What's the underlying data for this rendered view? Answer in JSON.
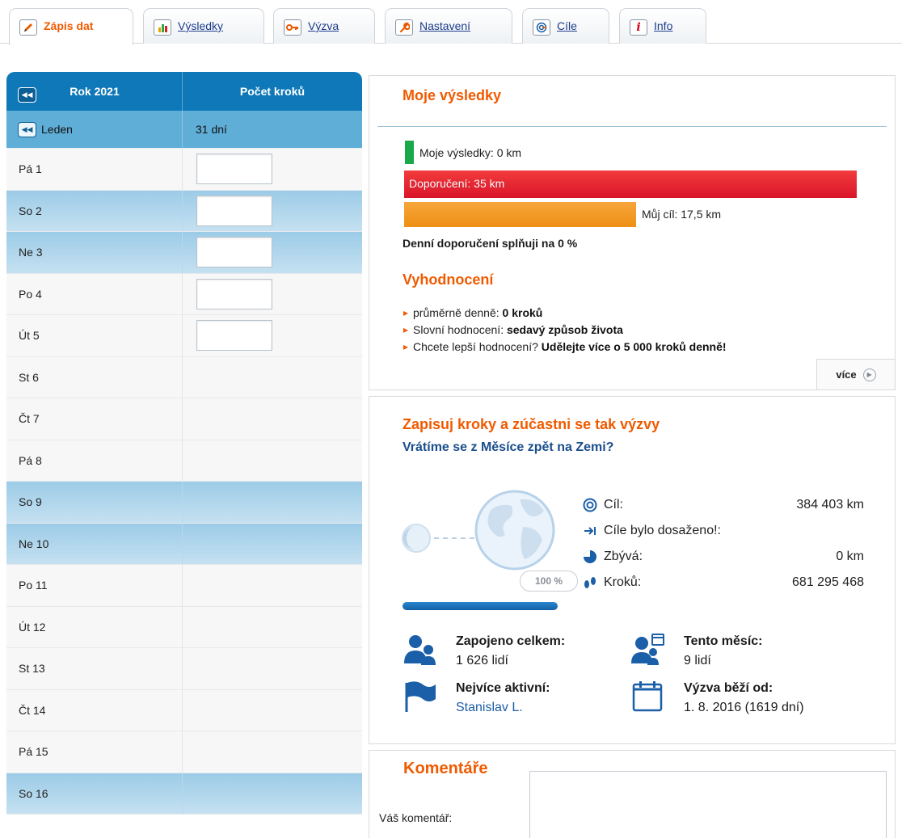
{
  "tabs": [
    {
      "label": "Zápis dat",
      "icon": "pencil-icon",
      "active": true
    },
    {
      "label": "Výsledky",
      "icon": "bar-chart-icon",
      "active": false
    },
    {
      "label": "Výzva",
      "icon": "key-icon",
      "active": false
    },
    {
      "label": "Nastavení",
      "icon": "wrench-icon",
      "active": false
    },
    {
      "label": "Cíle",
      "icon": "target-icon",
      "active": false
    },
    {
      "label": "Info",
      "icon": "info-icon",
      "active": false
    }
  ],
  "calendar": {
    "year_label": "Rok 2021",
    "steps_header": "Počet kroků",
    "month_label": "Leden",
    "month_days": "31 dní",
    "days": [
      {
        "label": "Pá 1",
        "weekend": false,
        "editable": true
      },
      {
        "label": "So 2",
        "weekend": true,
        "editable": true
      },
      {
        "label": "Ne 3",
        "weekend": true,
        "editable": true
      },
      {
        "label": "Po 4",
        "weekend": false,
        "editable": true
      },
      {
        "label": "Út 5",
        "weekend": false,
        "editable": true
      },
      {
        "label": "St 6",
        "weekend": false,
        "editable": false
      },
      {
        "label": "Čt 7",
        "weekend": false,
        "editable": false
      },
      {
        "label": "Pá 8",
        "weekend": false,
        "editable": false
      },
      {
        "label": "So 9",
        "weekend": true,
        "editable": false
      },
      {
        "label": "Ne 10",
        "weekend": true,
        "editable": false
      },
      {
        "label": "Po 11",
        "weekend": false,
        "editable": false
      },
      {
        "label": "Út 12",
        "weekend": false,
        "editable": false
      },
      {
        "label": "St 13",
        "weekend": false,
        "editable": false
      },
      {
        "label": "Čt 14",
        "weekend": false,
        "editable": false
      },
      {
        "label": "Pá 15",
        "weekend": false,
        "editable": false
      },
      {
        "label": "So 16",
        "weekend": true,
        "editable": false
      }
    ]
  },
  "results": {
    "title": "Moje výsledky",
    "mine_label": "Moje výsledky: 0 km",
    "recommended_label": "Doporučení: 35 km",
    "goal_label": "Můj cíl: 17,5 km",
    "daily_prefix": "Denní doporučení splňuji na",
    "daily_value": "0 %",
    "evaluation_title": "Vyhodnocení",
    "bullets": [
      {
        "text": "průměrně denně: ",
        "bold": "0 kroků"
      },
      {
        "text": "Slovní hodnocení: ",
        "bold": "sedavý způsob života"
      },
      {
        "text": "Chcete lepší hodnocení? ",
        "bold": "Udělejte více o 5 000 kroků denně!"
      }
    ],
    "more_label": "více",
    "colors": {
      "mine": "#19a84a",
      "recommended": "#e0202e",
      "goal": "#f09a22"
    }
  },
  "challenge": {
    "title": "Zapisuj kroky a zúčastni se tak výzvy",
    "subtitle": "Vrátíme se z Měsíce zpět na Zemi?",
    "progress_label": "100 %",
    "progress": 1.0,
    "stats": [
      {
        "icon": "target-icon",
        "label": "Cíl:",
        "value": "384 403 km"
      },
      {
        "icon": "arrow-to-line-icon",
        "label": "Cíle bylo dosaženo!:",
        "value": ""
      },
      {
        "icon": "pie-icon",
        "label": "Zbývá:",
        "value": "0 km"
      },
      {
        "icon": "footprints-icon",
        "label": "Kroků:",
        "value": "681 295 468"
      }
    ],
    "people": [
      {
        "icon": "people-icon",
        "heading": "Zapojeno celkem:",
        "value": "1 626 lidí",
        "link": false
      },
      {
        "icon": "people-calendar-icon",
        "heading": "Tento měsíc:",
        "value": "9 lidí",
        "link": false
      },
      {
        "icon": "flag-icon",
        "heading": "Nejvíce aktivní:",
        "value": "Stanislav L.",
        "link": true
      },
      {
        "icon": "calendar-icon",
        "heading": "Výzva běží od:",
        "value": "1. 8. 2016 (1619 dní)",
        "link": false
      }
    ]
  },
  "comments": {
    "title": "Komentáře",
    "label": "Váš komentář:",
    "value": ""
  }
}
